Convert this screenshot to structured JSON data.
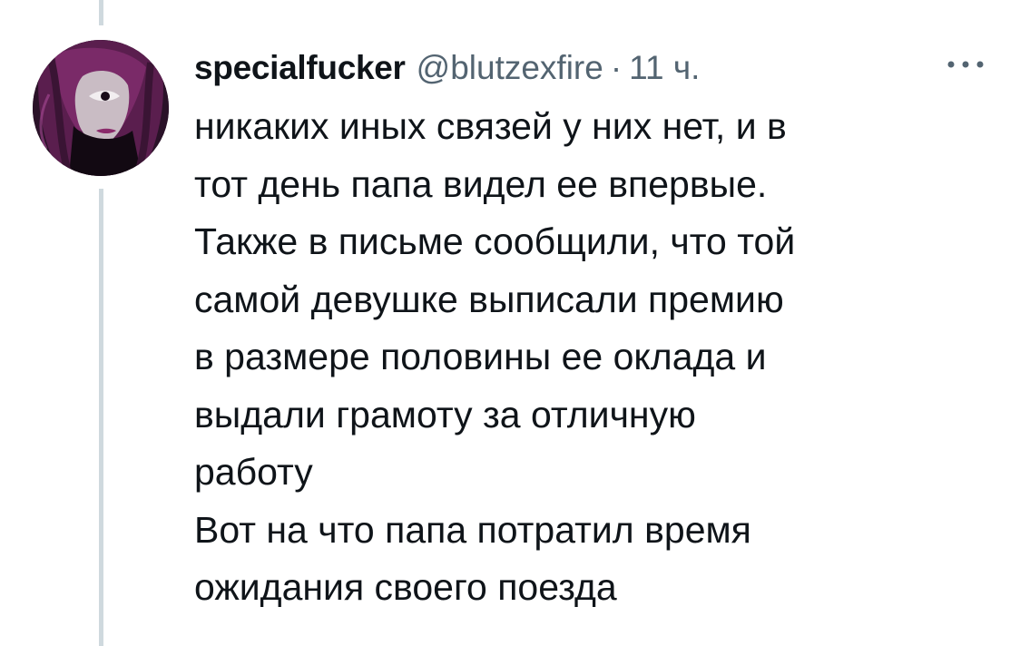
{
  "tweet": {
    "author_name": "specialfucker",
    "author_handle": "@blutzexfire",
    "separator": "·",
    "timestamp": "11 ч.",
    "avatar_icon": "avatar-dark-haired-character",
    "more_icon": "more-dots-icon",
    "text_lines": [
      "никаких иных связей у них нет, и в",
      "тот день папа видел ее впервые.",
      "Также в письме сообщили, что той",
      "самой девушке выписали премию",
      "в размере половины ее оклада и",
      "выдали грамоту за отличную",
      "работу",
      "Вот на что папа потратил время",
      "ожидания своего поезда"
    ]
  },
  "colors": {
    "text_primary": "#0f1419",
    "text_secondary": "#536471",
    "thread_line": "#cfd9de",
    "background": "#ffffff"
  }
}
